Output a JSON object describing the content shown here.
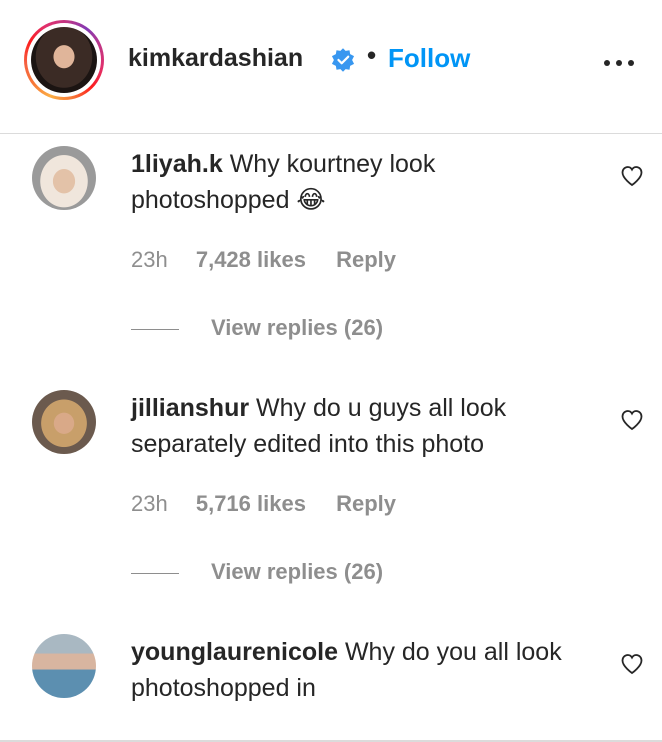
{
  "header": {
    "username": "kimkardashian",
    "verified": true,
    "separator": "•",
    "follow_label": "Follow",
    "more_icon": "more-horizontal-icon"
  },
  "comments": [
    {
      "username": "1liyah.k",
      "text": "Why kourtney look photoshopped 😂",
      "time": "23h",
      "likes": "7,428 likes",
      "reply_label": "Reply",
      "replies_label": "View replies (26)"
    },
    {
      "username": "jillianshur",
      "text": "Why do u guys all look separately edited into this photo",
      "time": "23h",
      "likes": "5,716 likes",
      "reply_label": "Reply",
      "replies_label": "View replies (26)"
    },
    {
      "username": "younglaurenicole",
      "text": "Why do you all look photoshopped in"
    }
  ],
  "colors": {
    "follow": "#0095f6",
    "verified_badge": "#3897f0",
    "text": "#262626",
    "secondary_text": "#8e8e8e",
    "divider": "#dbdbdb"
  }
}
